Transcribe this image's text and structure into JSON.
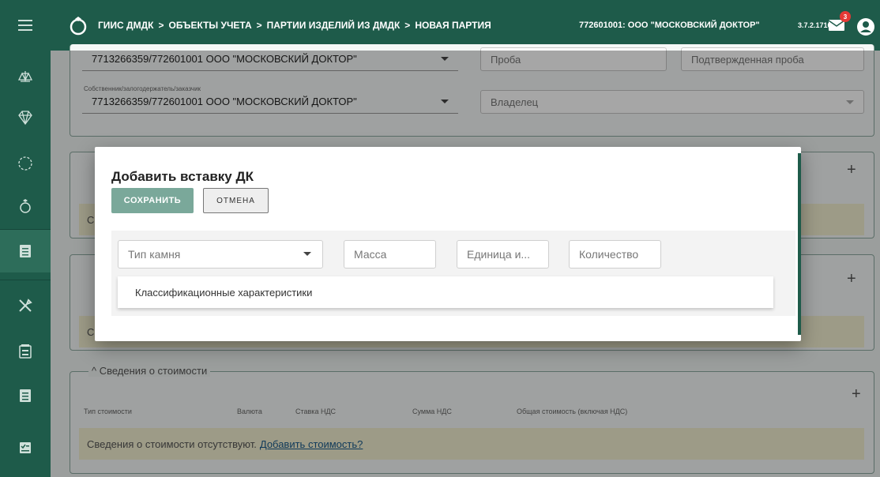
{
  "header": {
    "breadcrumb": [
      "ГИИС ДМДК",
      "ОБЪЕКТЫ УЧЕТА",
      "ПАРТИИ ИЗДЕЛИЙ ИЗ ДМДК",
      "НОВАЯ ПАРТИЯ"
    ],
    "separator": ">",
    "org": "772601001: ООО \"МОСКОВСКИЙ ДОКТОР\"",
    "version": "3.7.2.1716",
    "notifications": "3"
  },
  "sidebar": {
    "icons": [
      "scales-icon",
      "diamond-icon",
      "circle-icon",
      "ring-icon",
      "list-icon",
      "tools-icon",
      "id-card-icon",
      "document-icon",
      "checklist-icon"
    ]
  },
  "form": {
    "top_party_value": "7713266359/772601001 ООО \"МОСКОВСКИЙ ДОКТОР\"",
    "owner_label": "Собственник/залогодержатель/заказчик",
    "owner_value": "7713266359/772601001 ООО \"МОСКОВСКИЙ ДОКТОР\"",
    "probe_placeholder": "Проба",
    "confirmed_probe_placeholder": "Подтвержденная проба",
    "holder_placeholder": "Владелец"
  },
  "cost_section": {
    "title": "Сведения о стоимости",
    "columns": [
      "Тип стоимости",
      "Валюта",
      "Ставка НДС",
      "Сумма НДС",
      "Общая стоимость (включая НДС)"
    ],
    "empty_text": "Сведения о стоимости отсутствуют.",
    "add_link": "Добавить стоимость?"
  },
  "background_notices": {
    "first_prefix": "С",
    "second_prefix": "С"
  },
  "modal": {
    "title": "Добавить вставку ДК",
    "save_label": "СОХРАНИТЬ",
    "cancel_label": "ОТМЕНА",
    "stone_type": "Тип камня",
    "mass": "Масса",
    "unit": "Единица и...",
    "quantity": "Количество",
    "classification": "Классификационные характеристики"
  },
  "colors": {
    "primary": "#1e5b4a",
    "save_button": "#7aa89a",
    "notice_bg": "#f1eed0",
    "badge": "#e53935"
  }
}
